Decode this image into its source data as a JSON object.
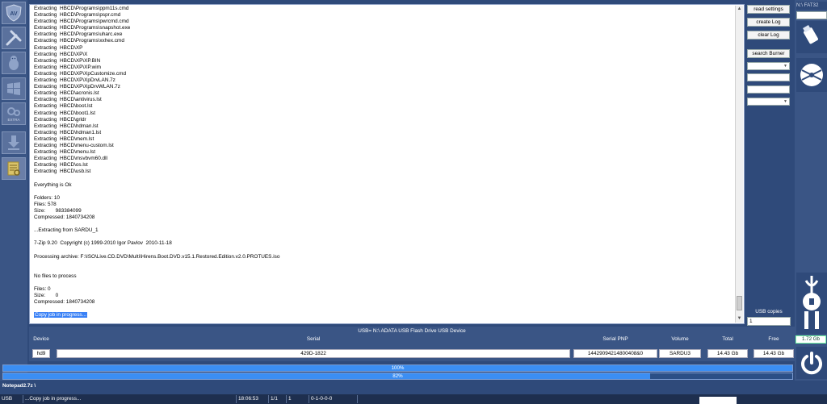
{
  "log": {
    "lines": [
      "Extracting  HBCD\\Programs\\ppm11s.cmd",
      "Extracting  HBCD\\Programs\\pspr.cmd",
      "Extracting  HBCD\\Programs\\pwrcmd.cmd",
      "Extracting  HBCD\\Programs\\snapshot.exe",
      "Extracting  HBCD\\Programs\\uharc.exe",
      "Extracting  HBCD\\Programs\\xxhex.cmd",
      "Extracting  HBCD\\XP",
      "Extracting  HBCD\\XP\\X",
      "Extracting  HBCD\\XP\\XP.BIN",
      "Extracting  HBCD\\XP\\XP.wim",
      "Extracting  HBCD\\XP\\XpCustomize.cmd",
      "Extracting  HBCD\\XP\\XpDrvLAN.7z",
      "Extracting  HBCD\\XP\\XpDrvWLAN.7z",
      "Extracting  HBCD\\acronis.lst",
      "Extracting  HBCD\\antivirus.lst",
      "Extracting  HBCD\\boot.lst",
      "Extracting  HBCD\\boot1.lst",
      "Extracting  HBCD\\grldr",
      "Extracting  HBCD\\hdman.lst",
      "Extracting  HBCD\\hdman1.lst",
      "Extracting  HBCD\\mem.lst",
      "Extracting  HBCD\\menu-custom.lst",
      "Extracting  HBCD\\menu.lst",
      "Extracting  HBCD\\msvbvm60.dll",
      "Extracting  HBCD\\os.lst",
      "Extracting  HBCD\\usb.lst",
      "",
      "Everything is Ok",
      "",
      "Folders: 10",
      "Files: 578",
      "Size:       983384099",
      "Compressed: 1840734208",
      "",
      "...Extracting from SARDU_1",
      "",
      "7-Zip 9.20  Copyright (c) 1999-2010 Igor Pavlov  2010-11-18",
      "",
      "Processing archive: F:\\ISO\\Live.CD.DVD\\Multi\\Hirens.Boot.DVD.v15.1.Restored.Edition.v2.0.PROTUES.iso",
      "",
      "",
      "No files to process",
      "",
      "Files: 0",
      "Size:       0",
      "Compressed: 1840734208",
      ""
    ],
    "highlight": "Copy job in progress..."
  },
  "buttons": {
    "read_settings": "read settings",
    "create_log": "create Log",
    "clear_log": "clear Log",
    "search_burner": "search Burner"
  },
  "usb_copies": {
    "label": "USB copies",
    "value": "1"
  },
  "drive": {
    "label": "N:\\  FAT32",
    "free": "1.72 Gb"
  },
  "device": {
    "title": "USB= N:\\  ADATA USB Flash Drive USB Device",
    "headers": {
      "device": "Device",
      "serial": "Serial",
      "serial_pnp": "Serial PNP",
      "volume": "Volume",
      "total": "Total",
      "free": "Free"
    },
    "values": {
      "device": "hd9",
      "serial": "429D-1822",
      "serial_pnp": "14429094214800408&0",
      "volume": "SARDU3",
      "total": "14.43 Gb",
      "free": "14.43 Gb"
    }
  },
  "progress": [
    {
      "label": "100%",
      "value": 100
    },
    {
      "label": "82%",
      "value": 82
    }
  ],
  "current_file": "Notepad2.7z \\",
  "status": {
    "mode": "USB",
    "message": "...Copy job in progress...",
    "time": "18:06:53",
    "count": "1/1",
    "index": "1",
    "code": "0-1-0-0-0"
  },
  "colors": {
    "accent": "#3b8ef3",
    "panel": "#3a5585",
    "background": "#2f4a7a"
  }
}
